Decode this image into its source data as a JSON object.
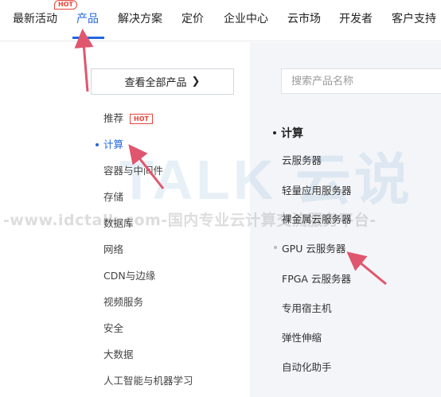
{
  "nav": {
    "items": [
      "最新活动",
      "产品",
      "解决方案",
      "定价",
      "企业中心",
      "云市场",
      "开发者",
      "客户支持"
    ],
    "active_index": 1,
    "hot_badge": "HOT"
  },
  "menu": {
    "view_all": "查看全部产品",
    "search_placeholder": "搜索产品名称",
    "categories": [
      {
        "label": "推荐",
        "badge": "HOT"
      },
      {
        "label": "计算"
      },
      {
        "label": "容器与中间件"
      },
      {
        "label": "存储"
      },
      {
        "label": "数据库"
      },
      {
        "label": "网络"
      },
      {
        "label": "CDN与边缘"
      },
      {
        "label": "视频服务"
      },
      {
        "label": "安全"
      },
      {
        "label": "大数据"
      },
      {
        "label": "人工智能与机器学习"
      }
    ],
    "active_category_index": 1,
    "section_title": "计算",
    "products": [
      "云服务器",
      "轻量应用服务器",
      "裸金属云服务器",
      "GPU 云服务器",
      "FPGA 云服务器",
      "专用宿主机",
      "弹性伸缩",
      "自动化助手"
    ]
  },
  "watermark": {
    "brand": "TALK 云说",
    "text": "-www.idctalk.com-国内专业云计算交流服务平台-"
  },
  "colors": {
    "accent": "#2266e0",
    "hot": "#e6453c",
    "annotation_arrow": "#e0566e",
    "right_panel_bg": "#f3f5f8"
  }
}
